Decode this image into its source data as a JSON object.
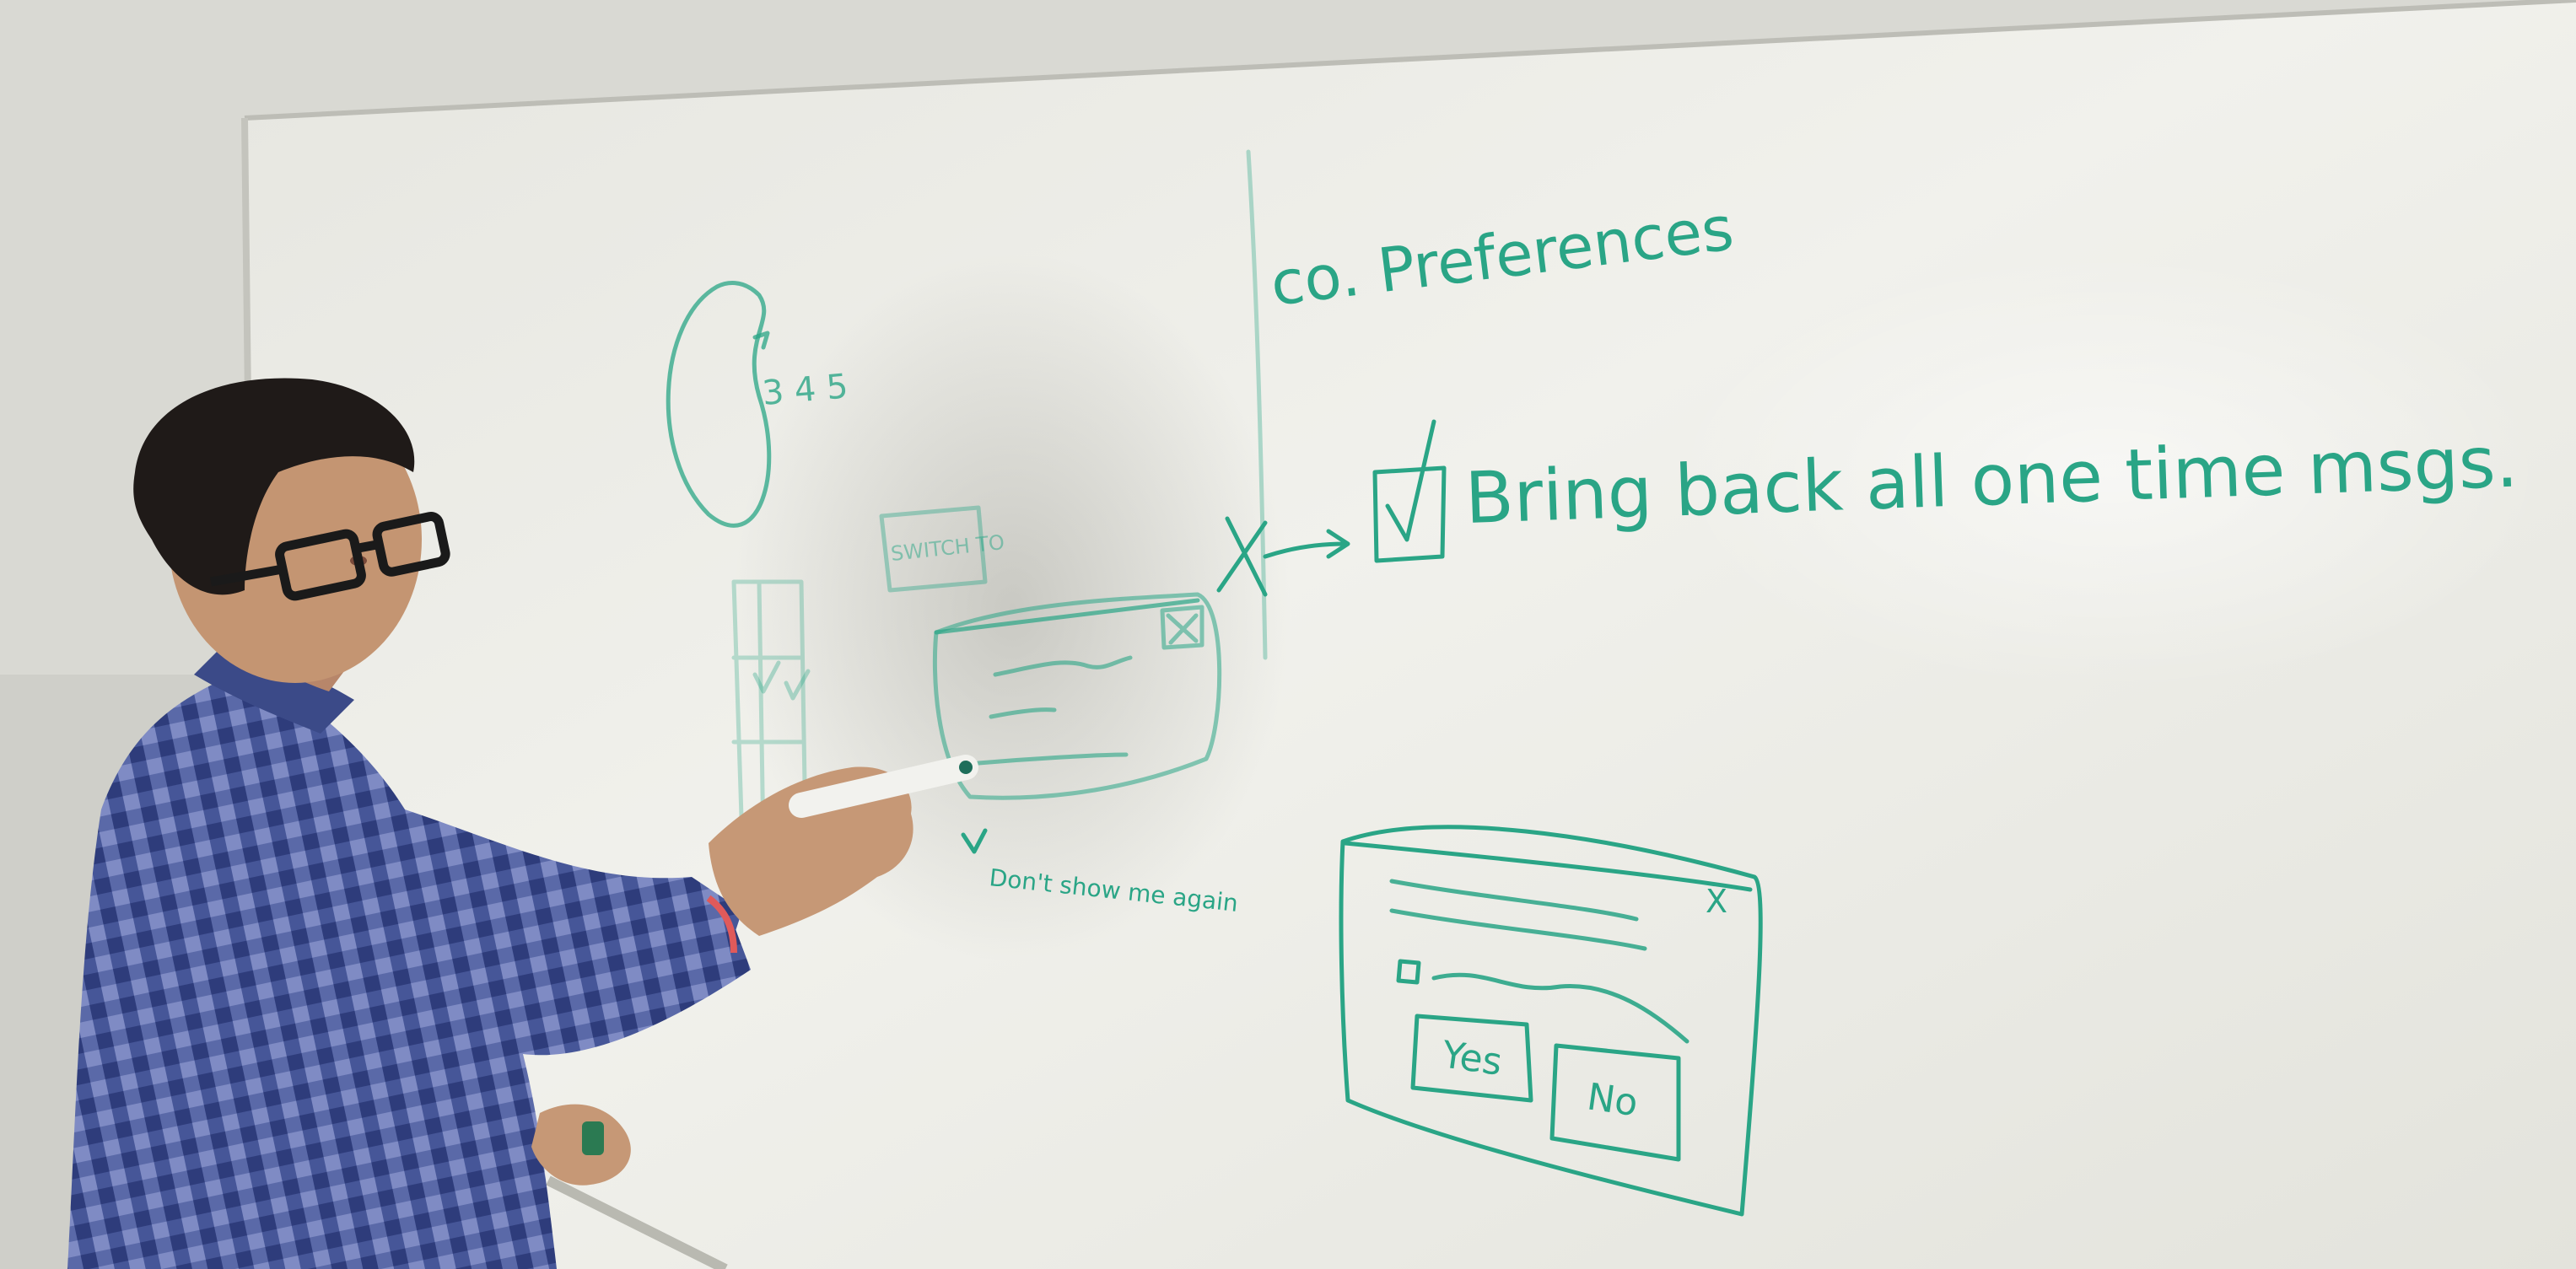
{
  "whiteboard": {
    "heading": "co. Preferences",
    "checkbox_option": "Bring back all one time msgs.",
    "sketch_numbers": "3 4 5",
    "small_label": "SWITCH TO",
    "under_dialog_note": "Don't show me again",
    "dialog_close_glyph": "X",
    "yes_button_label": "Yes",
    "no_button_label": "No"
  },
  "colors": {
    "marker_ink": "#2aa586",
    "wall": "#dcdcd6",
    "board": "#ecece6",
    "shirt": "#4c5c9a",
    "hair": "#1f1a18",
    "skin": "#c49572"
  }
}
